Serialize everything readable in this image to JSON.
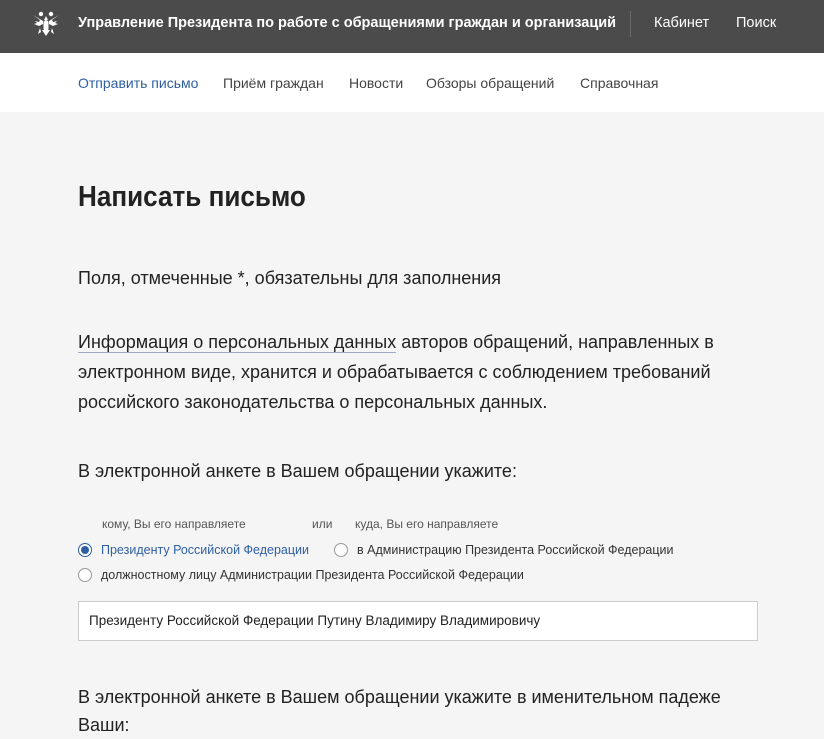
{
  "header": {
    "org_title": "Управление Президента по работе с обращениями граждан и организаций",
    "cabinet": "Кабинет",
    "search": "Поиск"
  },
  "nav": {
    "items": [
      "Отправить письмо",
      "Приём граждан",
      "Новости",
      "Обзоры обращений",
      "Справочная"
    ]
  },
  "main": {
    "title": "Написать письмо",
    "required_note": "Поля, отмеченные *, обязательны для заполнения",
    "info_link": "Информация о персональных данных",
    "info_rest": " авторов обращений, направленных в электронном виде, хранится и обрабатывается с соблюдением требований российского законодательства о персональных данных.",
    "instruction1": "В электронной анкете в Вашем обращении укажите:",
    "hint_to": "кому, Вы его направляете",
    "hint_or": "или",
    "hint_where": "куда, Вы его направляете",
    "radio_president": "Президенту Российской Федерации",
    "radio_administration": "в Администрацию Президента Российской Федерации",
    "radio_official": "должностному лицу Администрации Президента Российской Федерации",
    "addressee_value": "Президенту Российской Федерации Путину Владимиру Владимировичу",
    "instruction2": "В электронной анкете в Вашем обращении укажите в именительном падеже Ваши:"
  },
  "colors": {
    "topbar": "#4b4b4b",
    "accent": "#2e5fa3",
    "background": "#f5f5f5"
  }
}
